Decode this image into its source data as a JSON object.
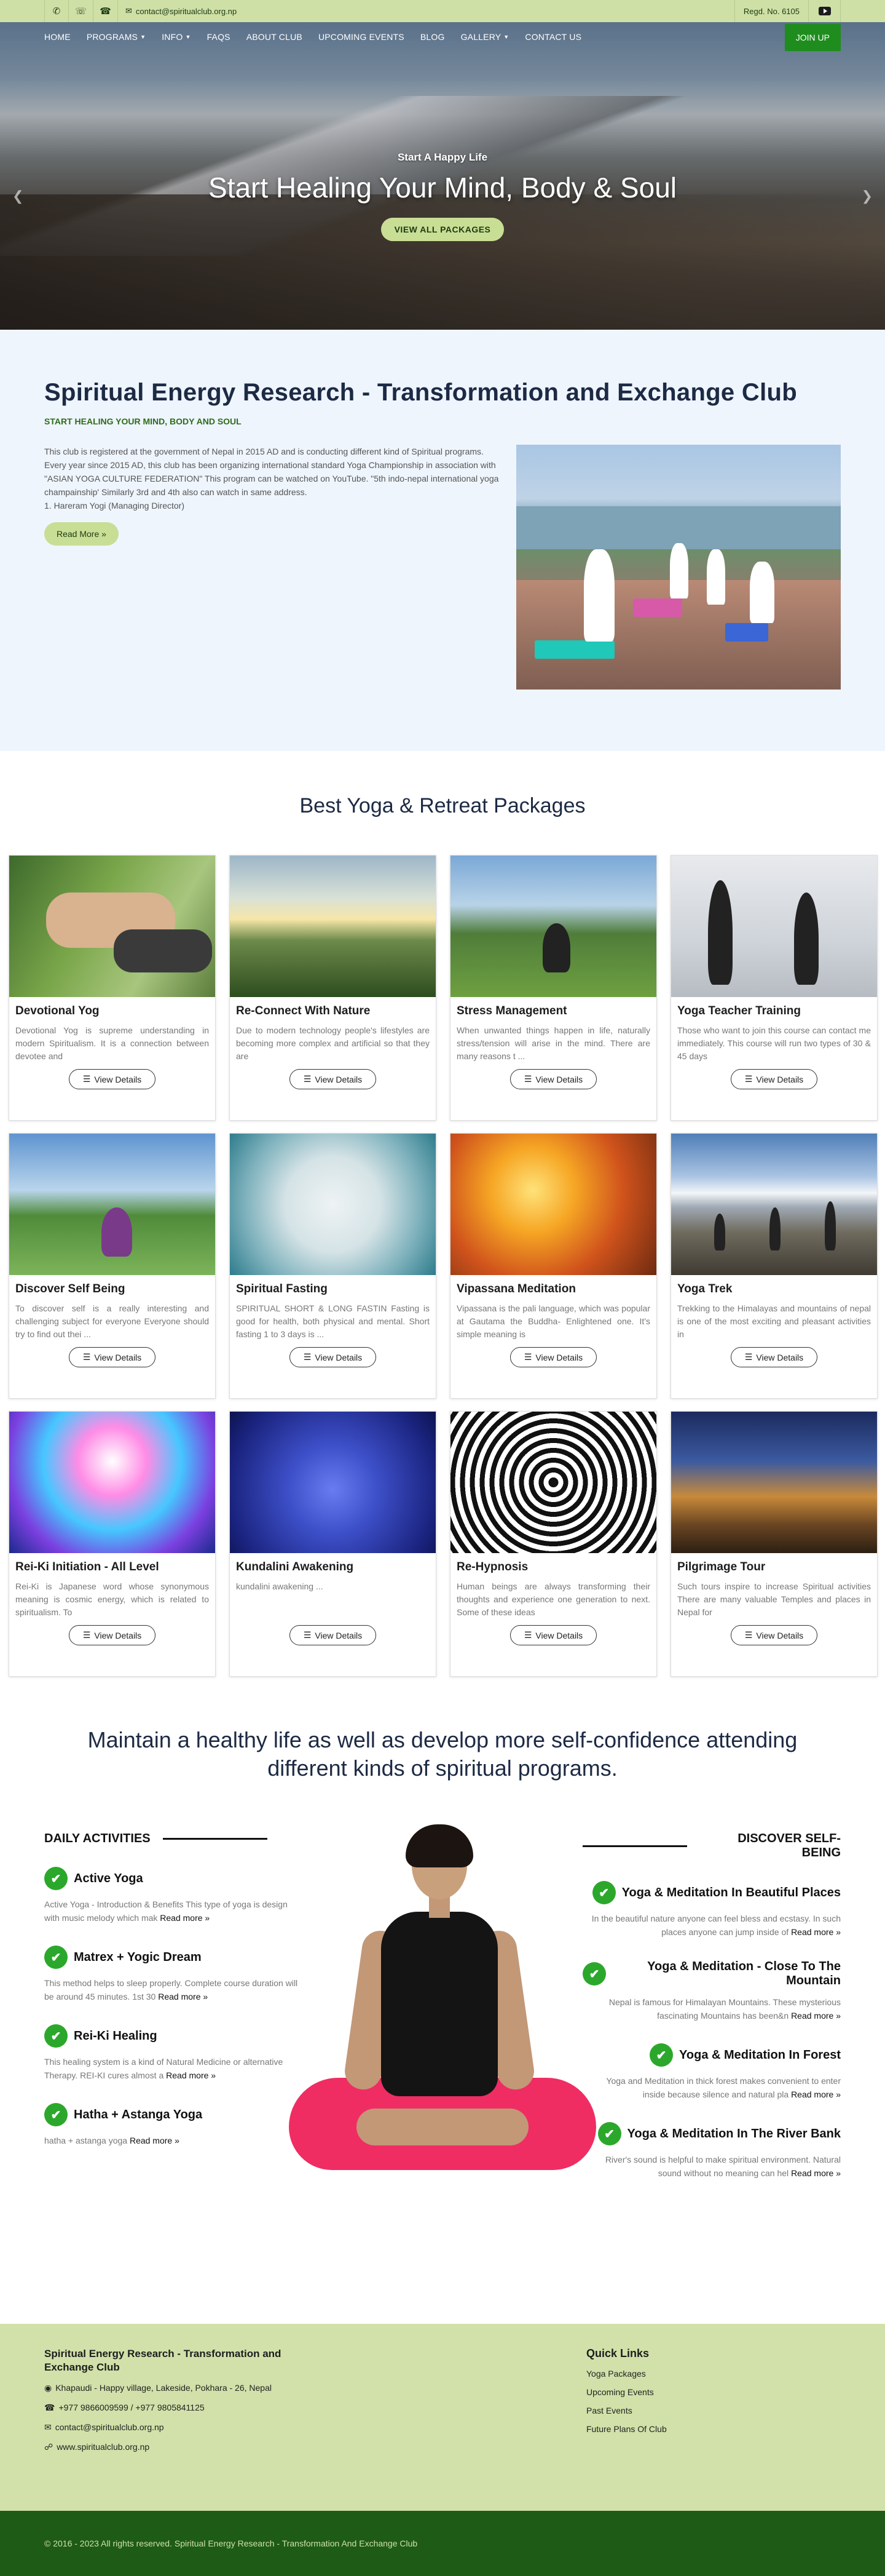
{
  "topbar": {
    "email": "contact@spiritualclub.org.np",
    "regd": "Regd. No. 6105"
  },
  "nav": {
    "items": [
      "HOME",
      "PROGRAMS",
      "INFO",
      "FAQS",
      "ABOUT CLUB",
      "UPCOMING EVENTS",
      "BLOG",
      "GALLERY",
      "CONTACT US"
    ],
    "join": "JOIN UP"
  },
  "hero": {
    "subtitle": "Start A Happy Life",
    "title": "Start Healing Your Mind, Body & Soul",
    "button": "VIEW ALL PACKAGES"
  },
  "about": {
    "title": "Spiritual Energy Research - Transformation and Exchange Club",
    "tagline": "START HEALING YOUR MIND, BODY AND SOUL",
    "p1": "This club is registered at the government of Nepal in 2015 AD and is conducting different kind of Spiritual programs.",
    "p2": "Every year since 2015 AD, this club has been organizing international standard Yoga Championship in association with \"ASIAN YOGA CULTURE FEDERATION\" This program can be watched on YouTube.  \"5th indo-nepal international yoga champainship' Similarly 3rd and 4th also can watch in same address.",
    "p3": "1. Hareram Yogi (Managing Director)",
    "readmore": "Read More"
  },
  "packages": {
    "heading": "Best Yoga & Retreat Packages",
    "button": "View Details",
    "items": [
      {
        "title": "Devotional Yog",
        "desc": "Devotional Yog is supreme understanding in modern Spiritualism. It is a connection between devotee and"
      },
      {
        "title": "Re-Connect With Nature",
        "desc": "Due to modern technology people's lifestyles are becoming more complex and artificial so that they are"
      },
      {
        "title": "Stress Management",
        "desc": "When unwanted things happen in life, naturally stress/tension will arise in the mind. There are many reasons t ..."
      },
      {
        "title": "Yoga Teacher Training",
        "desc": "Those who want to join this course can contact me immediately. This course will run two types of 30 & 45 days"
      },
      {
        "title": "Discover Self Being",
        "desc": "To discover self is a really interesting and challenging subject for everyone Everyone should try to find out thei ..."
      },
      {
        "title": "Spiritual Fasting",
        "desc": "SPIRITUAL SHORT & LONG FASTIN Fasting is good for health, both physical and mental. Short fasting 1 to 3 days is ..."
      },
      {
        "title": "Vipassana Meditation",
        "desc": "Vipassana is the pali language, which was popular at Gautama the Buddha- Enlightened one. It's simple meaning is"
      },
      {
        "title": "Yoga Trek",
        "desc": "Trekking to the Himalayas and mountains of nepal is one of the most exciting and pleasant activities in"
      },
      {
        "title": "Rei-Ki Initiation - All Level",
        "desc": "Rei-Ki is Japanese word whose synonymous meaning is cosmic energy, which is related to spiritualism. To"
      },
      {
        "title": "Kundalini Awakening",
        "desc": "kundalini awakening ..."
      },
      {
        "title": "Re-Hypnosis",
        "desc": "Human beings are always transforming their thoughts and experience one generation to next. Some of these ideas"
      },
      {
        "title": "Pilgrimage Tour",
        "desc": "Such tours inspire to increase Spiritual activities There are many valuable Temples and places in Nepal for"
      }
    ]
  },
  "maintain": {
    "heading": "Maintain a healthy life as well as develop more self-confidence attending different kinds of spiritual programs."
  },
  "daily": {
    "heading": "DAILY ACTIVITIES",
    "items": [
      {
        "title": "Active Yoga",
        "desc": "Active Yoga - Introduction & Benefits This type of yoga is design with music melody which mak",
        "rm": "Read more »"
      },
      {
        "title": "Matrex + Yogic Dream",
        "desc": "This method helps to sleep properly. Complete course duration will be around 45 minutes. 1st 30",
        "rm": "Read more »"
      },
      {
        "title": "Rei-Ki Healing",
        "desc": "This healing system is a kind of Natural Medicine or alternative Therapy. REI-KI cures almost a",
        "rm": "Read more »"
      },
      {
        "title": "Hatha + Astanga Yoga",
        "desc": "hatha + astanga yoga",
        "rm": "Read more »"
      }
    ]
  },
  "discover": {
    "heading": "DISCOVER SELF-BEING",
    "items": [
      {
        "title": "Yoga & Meditation In Beautiful Places",
        "desc": "In the beautiful nature anyone can feel bless and ecstasy. In such places anyone can jump inside of",
        "rm": "Read more »"
      },
      {
        "title": "Yoga & Meditation - Close To The Mountain",
        "desc": "Nepal is famous for Himalayan Mountains. These mysterious fascinating Mountains has been&n",
        "rm": "Read more »"
      },
      {
        "title": "Yoga & Meditation In Forest",
        "desc": "Yoga and Meditation in thick forest makes convenient to enter inside because silence and natural pla",
        "rm": "Read more »"
      },
      {
        "title": "Yoga & Meditation In The River Bank",
        "desc": "River's sound is helpful to make spiritual environment. Natural sound without no meaning can hel",
        "rm": "Read more »"
      }
    ]
  },
  "footer": {
    "title": "Spiritual Energy Research - Transformation and Exchange Club",
    "address": "Khapaudi - Happy village, Lakeside, Pokhara - 26, Nepal",
    "phone": "+977 9866009599  / +977 9805841125",
    "email": "contact@spiritualclub.org.np",
    "web": "www.spiritualclub.org.np",
    "quick_title": "Quick Links",
    "links": [
      "Yoga Packages",
      "Upcoming Events",
      "Past Events",
      "Future Plans Of Club"
    ],
    "copyright": "© 2016 - 2023 All rights reserved. Spiritual Energy Research - Transformation And Exchange Club"
  },
  "colors": {
    "accent_green": "#1e8d1e",
    "light_green": "#c9de95",
    "dark_footer": "#1e5b17"
  }
}
